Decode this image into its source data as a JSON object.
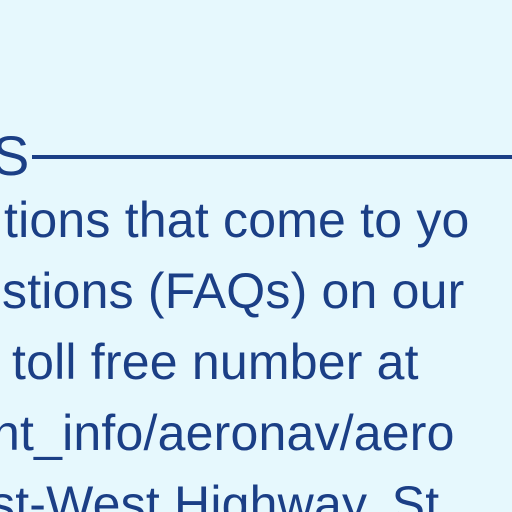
{
  "section": {
    "heading": "S",
    "lines": [
      "tions that come to yo",
      "stions (FAQs) on our",
      "toll free number at",
      "ht_info/aeronav/aero",
      "st-West Highway, St"
    ]
  },
  "colors": {
    "background": "#e6f8fd",
    "text": "#1b3f86"
  }
}
